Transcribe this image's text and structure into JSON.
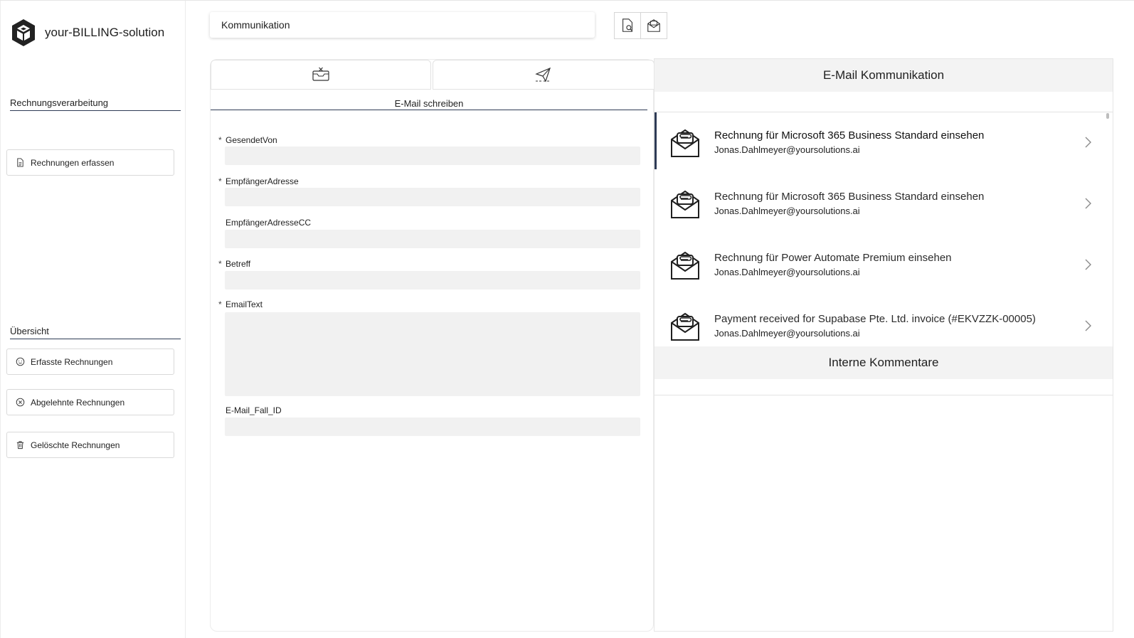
{
  "app": {
    "name": "your-BILLING-solution",
    "logo_icon": "cube-logo-icon"
  },
  "sidebar": {
    "sections": [
      {
        "title": "Rechnungsverarbeitung"
      },
      {
        "title": "Übersicht"
      }
    ],
    "items": [
      {
        "label": "Rechnungen erfassen",
        "icon": "document-icon"
      },
      {
        "label": "Erfasste Rechnungen",
        "icon": "smiley-icon"
      },
      {
        "label": "Abgelehnte Rechnungen",
        "icon": "x-circle-icon"
      },
      {
        "label": "Gelöschte Rechnungen",
        "icon": "trash-icon"
      }
    ]
  },
  "topbar": {
    "title": "Kommunikation",
    "buttons": [
      {
        "icon": "document-search-icon"
      },
      {
        "icon": "mail-open-icon"
      }
    ]
  },
  "compose": {
    "tabs": [
      {
        "icon": "discard-mail-icon"
      },
      {
        "icon": "send-icon"
      }
    ],
    "heading": "E-Mail schreiben",
    "fields": [
      {
        "label": "GesendetVon",
        "required": "*",
        "value": ""
      },
      {
        "label": "EmpfängerAdresse",
        "required": "*",
        "value": ""
      },
      {
        "label": "EmpfängerAdresseCC",
        "required": "",
        "value": ""
      },
      {
        "label": "Betreff",
        "required": "*",
        "value": ""
      },
      {
        "label": "EmailText",
        "required": "*",
        "value": ""
      },
      {
        "label": "E-Mail_Fall_ID",
        "required": "",
        "value": ""
      }
    ]
  },
  "mail_panel": {
    "title": "E-Mail Kommunikation",
    "emails": [
      {
        "subject": "Rechnung für Microsoft 365 Business Standard einsehen",
        "sender": "Jonas.Dahlmeyer@yoursolutions.ai",
        "selected": true
      },
      {
        "subject": "Rechnung für Microsoft 365 Business Standard einsehen",
        "sender": "Jonas.Dahlmeyer@yoursolutions.ai",
        "selected": false
      },
      {
        "subject": "Rechnung für Power Automate Premium einsehen",
        "sender": "Jonas.Dahlmeyer@yoursolutions.ai",
        "selected": false
      },
      {
        "subject": "Payment received for Supabase Pte. Ltd. invoice (#EKVZZK-00005)",
        "sender": "Jonas.Dahlmeyer@yoursolutions.ai",
        "selected": false
      }
    ],
    "comments_title": "Interne Kommentare"
  },
  "colors": {
    "accent": "#2e3b55",
    "input_bg": "#f1f1f1",
    "header_bg": "#f3f3f3"
  }
}
